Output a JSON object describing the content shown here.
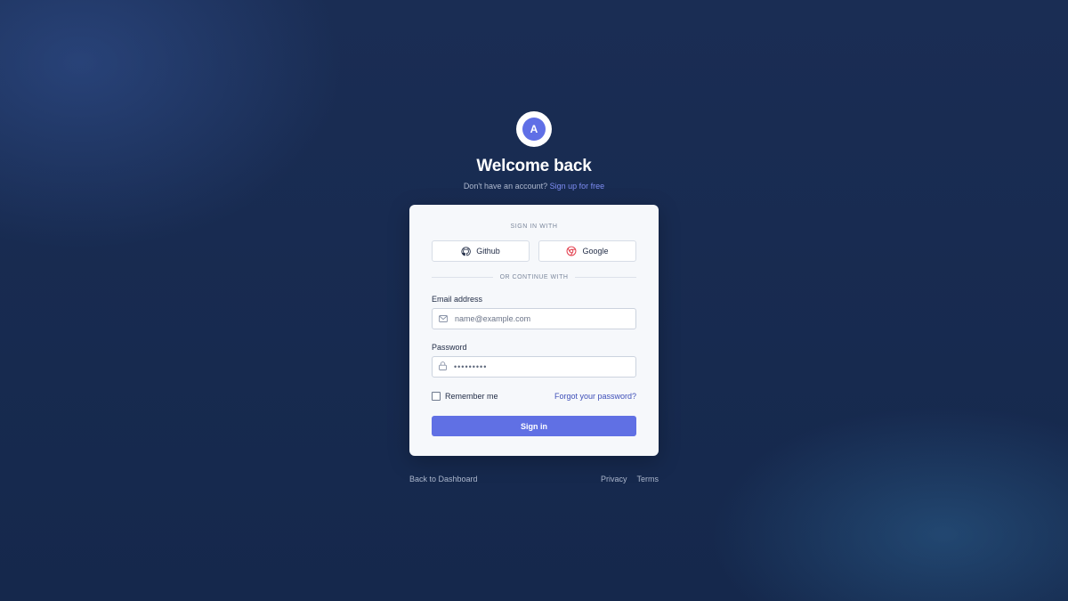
{
  "brand": {
    "logo_letter": "A",
    "accent_color": "#5f6fe6"
  },
  "header": {
    "title": "Welcome back",
    "subtitle_text": "Don't have an account?",
    "signup_link": "Sign up for free"
  },
  "card": {
    "sign_in_with_label": "SIGN IN WITH",
    "social": [
      {
        "label": "Github",
        "icon": "github-icon"
      },
      {
        "label": "Google",
        "icon": "chrome-icon"
      }
    ],
    "divider_text": "OR CONTINUE WITH",
    "email": {
      "label": "Email address",
      "placeholder": "name@example.com",
      "icon": "mail-icon"
    },
    "password": {
      "label": "Password",
      "value_masked": "•••••••••",
      "icon": "lock-icon"
    },
    "remember_label": "Remember me",
    "remember_checked": false,
    "forgot_link": "Forgot your password?",
    "submit_label": "Sign in"
  },
  "footer": {
    "back_link": "Back to Dashboard",
    "privacy_link": "Privacy",
    "terms_link": "Terms"
  }
}
